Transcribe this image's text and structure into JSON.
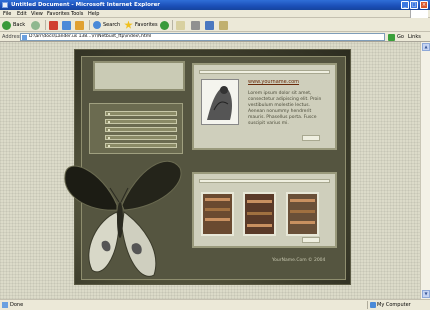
{
  "window": {
    "title": "Untitled Document - Microsoft Internet Explorer",
    "buttons": {
      "minimize": "_",
      "maximize": "□",
      "close": "×"
    }
  },
  "menu": [
    "File",
    "Edit",
    "View",
    "Favorites",
    "Tools",
    "Help"
  ],
  "toolbar": {
    "back": "Back",
    "search": "Search",
    "favorites": "Favorites"
  },
  "address": {
    "label": "Address",
    "url": "D:\\arr\\docs\\Lander.us 138...\\rr\\Netbuilt_ftp\\index\\.html",
    "go": "Go",
    "links": "Links"
  },
  "site": {
    "link": "www.yourname.com",
    "body": "Lorem ipsum dolor sit amet, consectetur adipiscing elit. Proin vestibulum molestie lectus. Aenean nonummy hendrerit mauris. Phasellus porta. Fusce suscipit varius mi.",
    "copyright": "YourName.Com © 2004",
    "nav_items": 5,
    "thumbnails": 3
  },
  "status": {
    "text": "Done",
    "zone": "My Computer"
  }
}
